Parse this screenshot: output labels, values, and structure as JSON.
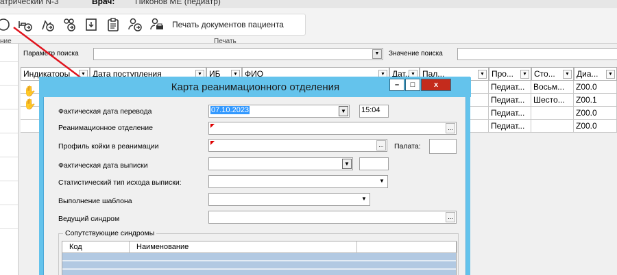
{
  "header": {
    "left_text": "атрический N-3",
    "doctor_label": "Врач:",
    "doctor_name": "Пиконов МЕ (педиатр)"
  },
  "ribbon": {
    "left_group_label": "ние",
    "print_group_label": "Печать",
    "print_docs_label": "Печать документов пациента"
  },
  "search": {
    "param_label": "Параметр поиска",
    "value_label": "Значение поиска",
    "param_value": "",
    "value_value": ""
  },
  "grid": {
    "columns": [
      "Индикаторы",
      "Дата поступления",
      "ИБ",
      "ФИО",
      "Дат...",
      "Пал...",
      "Про...",
      "Сто...",
      "Диа..."
    ],
    "rows": [
      {
        "pro": "Педиат...",
        "sto": "Восьм...",
        "dia": "Z00.0"
      },
      {
        "pro": "Педиат...",
        "sto": "Шесто...",
        "dia": "Z00.1"
      },
      {
        "pro": "Педиат...",
        "sto": "",
        "dia": "Z00.0"
      },
      {
        "pro": "Педиат...",
        "sto": "",
        "dia": "Z00.0"
      }
    ]
  },
  "dialog": {
    "title": "Карта реанимационного отделения",
    "minimize": "–",
    "maximize": "□",
    "close": "x",
    "fields": {
      "transfer_date_label": "Фактическая дата перевода",
      "transfer_date_value": "07.10.2023",
      "transfer_time_value": "15:04",
      "icu_dept_label": "Реанимационное отделение",
      "bed_profile_label": "Профиль койки в реанимации",
      "ward_label": "Палата:",
      "discharge_date_label": "Фактическая дата выписки",
      "stat_outcome_label": "Статистический тип исхода выписки:",
      "template_label": "Выполнение шаблона",
      "leading_syndrome_label": "Ведущий синдром"
    },
    "syndromes": {
      "legend": "Сопутствующие синдромы",
      "col_code": "Код",
      "col_name": "Наименование"
    }
  },
  "colors": {
    "title_bar": "#64c3ec",
    "close_button": "#c42b1c",
    "selection": "#3399ff",
    "arrow": "#e0141e",
    "required_mark": "#dd0000"
  }
}
